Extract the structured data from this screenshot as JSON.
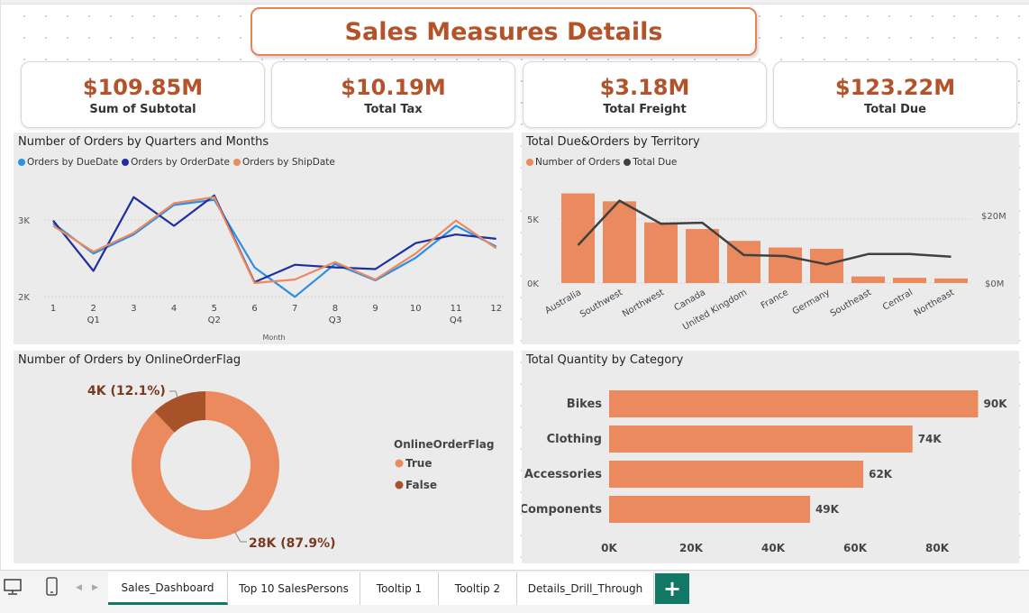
{
  "title": "Sales Measures Details",
  "kpis": [
    {
      "value": "$109.85M",
      "label": "Sum of Subtotal"
    },
    {
      "value": "$10.19M",
      "label": "Total Tax"
    },
    {
      "value": "$3.18M",
      "label": "Total Freight"
    },
    {
      "value": "$123.22M",
      "label": "Total Due"
    }
  ],
  "line_panel": {
    "title": "Number of Orders by Quarters and Months",
    "legend": [
      "Orders by DueDate",
      "Orders by OrderDate",
      "Orders by ShipDate"
    ],
    "y_ticks": [
      "3K",
      "2K"
    ],
    "months": [
      "1",
      "2",
      "3",
      "4",
      "5",
      "6",
      "7",
      "8",
      "9",
      "10",
      "11",
      "12"
    ],
    "quarters": [
      "Q1",
      "Q2",
      "Q3",
      "Q4"
    ],
    "xlabel": "Month"
  },
  "territory_panel": {
    "title": "Total Due&Orders by Territory",
    "legend": [
      "Number of Orders",
      "Total Due"
    ],
    "y_left": [
      "5K",
      "0K"
    ],
    "y_right": [
      "$20M",
      "$0M"
    ]
  },
  "donut_panel": {
    "title": "Number of Orders by OnlineOrderFlag",
    "label_false": "4K (12.1%)",
    "label_true": "28K (87.9%)",
    "legend_title": "OnlineOrderFlag",
    "legend": [
      "True",
      "False"
    ]
  },
  "category_panel": {
    "title": "Total Quantity by Category",
    "x_ticks": [
      "0K",
      "20K",
      "40K",
      "60K",
      "80K"
    ]
  },
  "tabs": [
    "Sales_Dashboard",
    "Top 10 SalesPersons",
    "Tooltip 1",
    "Tooltip 2",
    "Details_Drill_Through"
  ],
  "add_tab": "+",
  "colors": {
    "accent": "#b4522a",
    "orange": "#ea8a5e",
    "blue": "#2d8fe6",
    "navy": "#1f2fa0",
    "dark": "#404040",
    "brown": "#a8522a",
    "teal": "#117865"
  },
  "chart_data": [
    {
      "type": "line",
      "title": "Number of Orders by Quarters and Months",
      "xlabel": "Month",
      "x": [
        1,
        2,
        3,
        4,
        5,
        6,
        7,
        8,
        9,
        10,
        11,
        12
      ],
      "ylim": [
        1900,
        3200
      ],
      "series": [
        {
          "name": "Orders by DueDate",
          "values": [
            2830,
            2480,
            2700,
            3040,
            3100,
            2320,
            1980,
            2360,
            2170,
            2430,
            2800,
            2560
          ]
        },
        {
          "name": "Orders by OrderDate",
          "values": [
            2860,
            2280,
            3130,
            2800,
            3150,
            2150,
            2350,
            2320,
            2300,
            2600,
            2700,
            2650
          ]
        },
        {
          "name": "Orders by ShipDate",
          "values": [
            2800,
            2500,
            2720,
            3060,
            3130,
            2140,
            2180,
            2380,
            2180,
            2480,
            2860,
            2540
          ]
        }
      ]
    },
    {
      "type": "bar",
      "title": "Total Due&Orders by Territory",
      "categories": [
        "Australia",
        "Southwest",
        "Northwest",
        "Canada",
        "United Kingdom",
        "France",
        "Germany",
        "Southeast",
        "Central",
        "Northeast"
      ],
      "series": [
        {
          "name": "Number of Orders",
          "values": [
            6800,
            6200,
            4600,
            4100,
            3200,
            2700,
            2600,
            500,
            400,
            350
          ]
        },
        {
          "name": "Total Due",
          "values": [
            11500,
            25000,
            18000,
            18300,
            8500,
            8200,
            5700,
            8800,
            8800,
            8000
          ]
        }
      ],
      "ylim_left": [
        0,
        8000
      ],
      "ylim_right": [
        0,
        32000000
      ]
    },
    {
      "type": "pie",
      "title": "Number of Orders by OnlineOrderFlag",
      "categories": [
        "True",
        "False"
      ],
      "values": [
        87.9,
        12.1
      ]
    },
    {
      "type": "bar",
      "title": "Total Quantity by Category",
      "categories": [
        "Bikes",
        "Clothing",
        "Accessories",
        "Components"
      ],
      "values": [
        90000,
        74000,
        62000,
        49000
      ],
      "labels": [
        "90K",
        "74K",
        "62K",
        "49K"
      ],
      "xlim": [
        0,
        100000
      ]
    }
  ]
}
